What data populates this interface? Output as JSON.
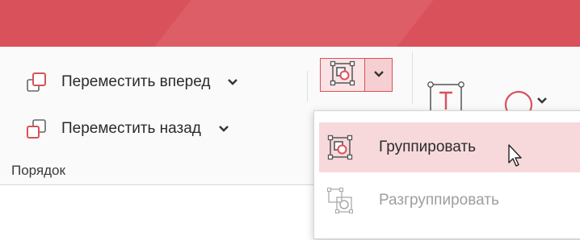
{
  "ribbon": {
    "bring_forward": {
      "label": "Переместить вперед",
      "icon": "bring-forward-icon"
    },
    "send_backward": {
      "label": "Переместить назад",
      "icon": "send-backward-icon"
    },
    "group_label": "Порядок",
    "group_button": {
      "icon": "group-objects-icon",
      "state": "pressed"
    }
  },
  "dropdown": {
    "items": [
      {
        "label": "Группировать",
        "icon": "group-icon",
        "state": "hover"
      },
      {
        "label": "Разгруппировать",
        "icon": "ungroup-icon",
        "state": "disabled"
      }
    ]
  },
  "colors": {
    "accent": "#d9515b",
    "accent_light": "#fbe3e5",
    "hover": "#f7d9dc",
    "disabled_text": "#9e9e9e"
  }
}
